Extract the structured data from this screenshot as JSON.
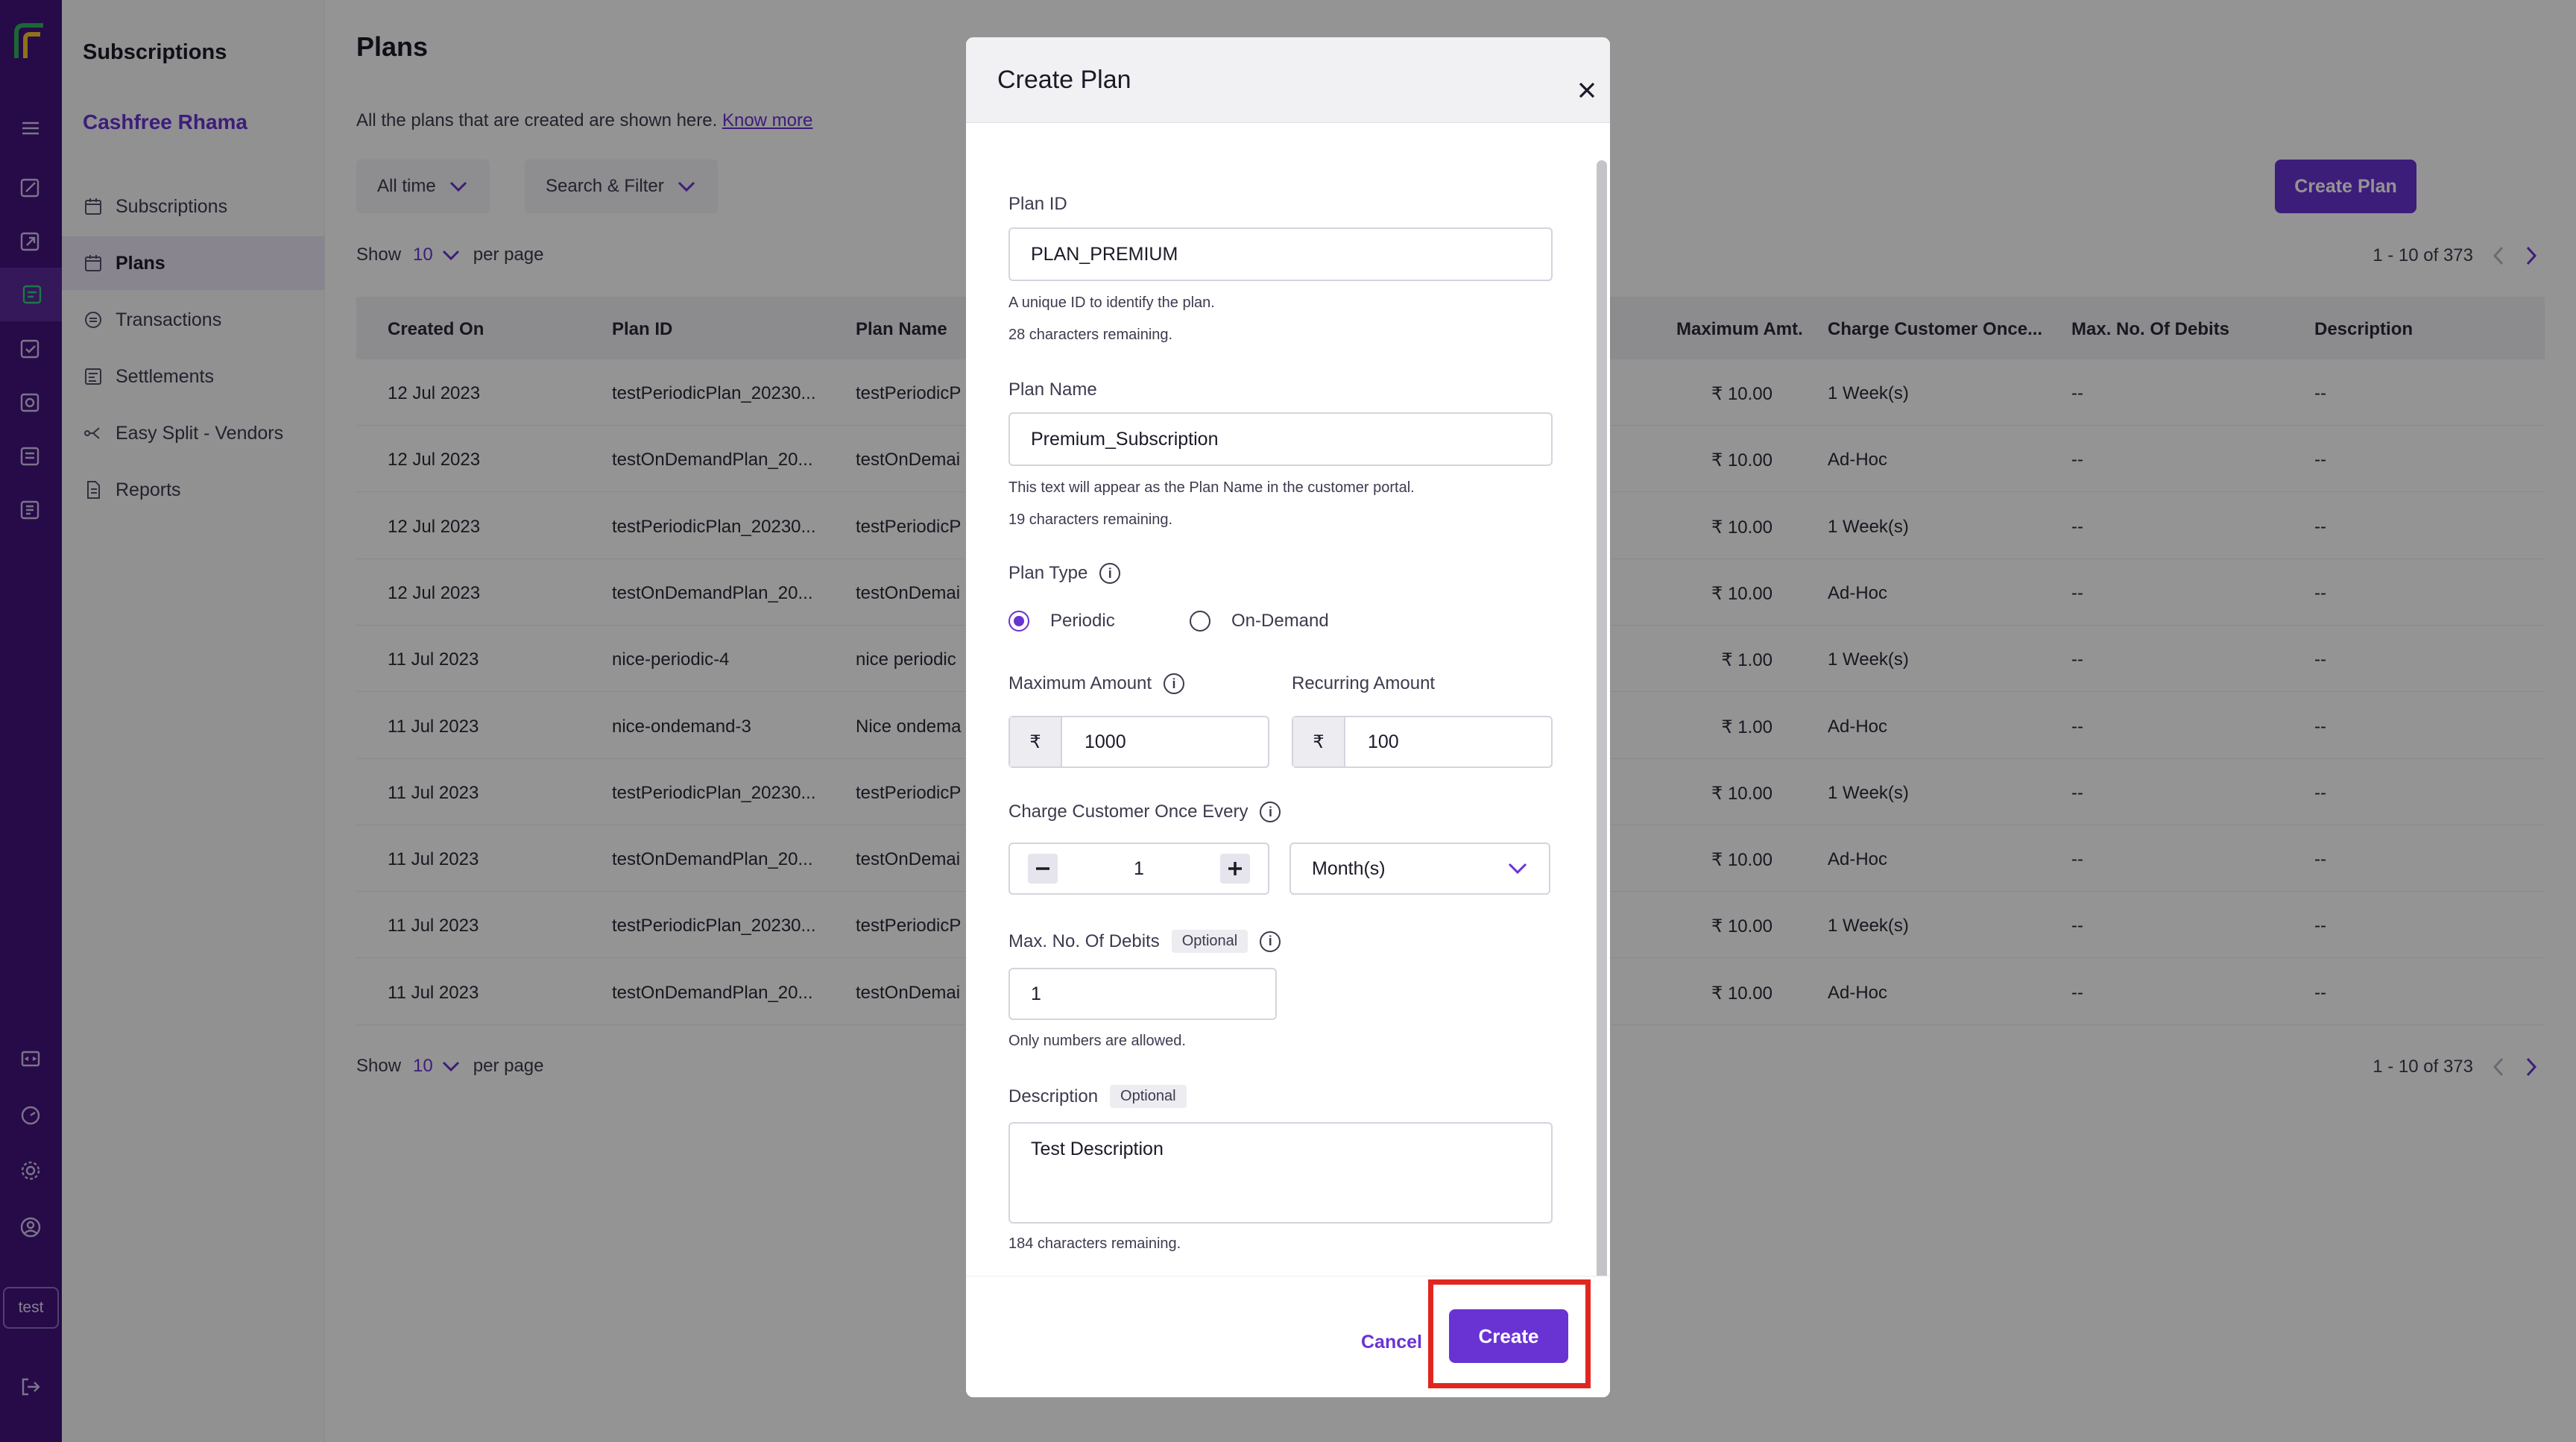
{
  "rail": {
    "test_label": "test"
  },
  "sidebar": {
    "section_title": "Subscriptions",
    "merchant": "Cashfree Rhama",
    "items": [
      {
        "label": "Subscriptions",
        "icon": "calendar-icon"
      },
      {
        "label": "Plans",
        "icon": "calendar-icon"
      },
      {
        "label": "Transactions",
        "icon": "exchange-icon"
      },
      {
        "label": "Settlements",
        "icon": "settlement-icon"
      },
      {
        "label": "Easy Split - Vendors",
        "icon": "split-icon"
      },
      {
        "label": "Reports",
        "icon": "document-icon"
      }
    ]
  },
  "page": {
    "title": "Plans",
    "intro": "All the plans that are created are shown here.",
    "know_more": "Know more",
    "filter_time": "All time",
    "filter_search": "Search & Filter",
    "create_plan": "Create Plan",
    "show_label": "Show",
    "per_page_value": "10",
    "per_page_label": "per page",
    "pager_text": "1 - 10 of 373"
  },
  "table": {
    "headers": [
      "Created On",
      "Plan ID",
      "Plan Name",
      "Maximum Amt.",
      "Charge Customer Once...",
      "Max. No. Of Debits",
      "Description"
    ],
    "rows": [
      {
        "created": "12 Jul 2023",
        "plan_id": "testPeriodicPlan_20230...",
        "plan_name": "testPeriodicP",
        "max_amt": "₹ 10.00",
        "charge": "1 Week(s)",
        "debits": "--",
        "desc": "--"
      },
      {
        "created": "12 Jul 2023",
        "plan_id": "testOnDemandPlan_20...",
        "plan_name": "testOnDemai",
        "max_amt": "₹ 10.00",
        "charge": "Ad-Hoc",
        "debits": "--",
        "desc": "--"
      },
      {
        "created": "12 Jul 2023",
        "plan_id": "testPeriodicPlan_20230...",
        "plan_name": "testPeriodicP",
        "max_amt": "₹ 10.00",
        "charge": "1 Week(s)",
        "debits": "--",
        "desc": "--"
      },
      {
        "created": "12 Jul 2023",
        "plan_id": "testOnDemandPlan_20...",
        "plan_name": "testOnDemai",
        "max_amt": "₹ 10.00",
        "charge": "Ad-Hoc",
        "debits": "--",
        "desc": "--"
      },
      {
        "created": "11 Jul 2023",
        "plan_id": "nice-periodic-4",
        "plan_name": "nice periodic",
        "max_amt": "₹ 1.00",
        "charge": "1 Week(s)",
        "debits": "--",
        "desc": "--"
      },
      {
        "created": "11 Jul 2023",
        "plan_id": "nice-ondemand-3",
        "plan_name": "Nice ondema",
        "max_amt": "₹ 1.00",
        "charge": "Ad-Hoc",
        "debits": "--",
        "desc": "--"
      },
      {
        "created": "11 Jul 2023",
        "plan_id": "testPeriodicPlan_20230...",
        "plan_name": "testPeriodicP",
        "max_amt": "₹ 10.00",
        "charge": "1 Week(s)",
        "debits": "--",
        "desc": "--"
      },
      {
        "created": "11 Jul 2023",
        "plan_id": "testOnDemandPlan_20...",
        "plan_name": "testOnDemai",
        "max_amt": "₹ 10.00",
        "charge": "Ad-Hoc",
        "debits": "--",
        "desc": "--"
      },
      {
        "created": "11 Jul 2023",
        "plan_id": "testPeriodicPlan_20230...",
        "plan_name": "testPeriodicP",
        "max_amt": "₹ 10.00",
        "charge": "1 Week(s)",
        "debits": "--",
        "desc": "--"
      },
      {
        "created": "11 Jul 2023",
        "plan_id": "testOnDemandPlan_20...",
        "plan_name": "testOnDemai",
        "max_amt": "₹ 10.00",
        "charge": "Ad-Hoc",
        "debits": "--",
        "desc": "--"
      }
    ]
  },
  "modal": {
    "title": "Create Plan",
    "plan_id_label": "Plan ID",
    "plan_id_value": "PLAN_PREMIUM",
    "plan_id_help": "A unique ID to identify the plan.",
    "plan_id_remaining": "28 characters remaining.",
    "plan_name_label": "Plan Name",
    "plan_name_value": "Premium_Subscription",
    "plan_name_help": "This text will appear as the Plan Name in the customer portal.",
    "plan_name_remaining": "19 characters remaining.",
    "plan_type_label": "Plan Type",
    "plan_type_options": [
      "Periodic",
      "On-Demand"
    ],
    "plan_type_selected": "Periodic",
    "max_amount_label": "Maximum Amount",
    "max_amount_currency": "₹",
    "max_amount_value": "1000",
    "recurring_amount_label": "Recurring Amount",
    "recurring_amount_currency": "₹",
    "recurring_amount_value": "100",
    "charge_every_label": "Charge Customer Once Every",
    "charge_every_value": "1",
    "charge_every_unit": "Month(s)",
    "max_debits_label": "Max. No. Of Debits",
    "optional_tag": "Optional",
    "max_debits_value": "1",
    "max_debits_help": "Only numbers are allowed.",
    "description_label": "Description",
    "description_value": "Test Description",
    "description_remaining": "184 characters remaining.",
    "info_glyph": "i",
    "cancel_label": "Cancel",
    "create_label": "Create"
  },
  "colors": {
    "brand": "#6933d3",
    "rail": "#43147c",
    "highlight": "#e0271f"
  }
}
